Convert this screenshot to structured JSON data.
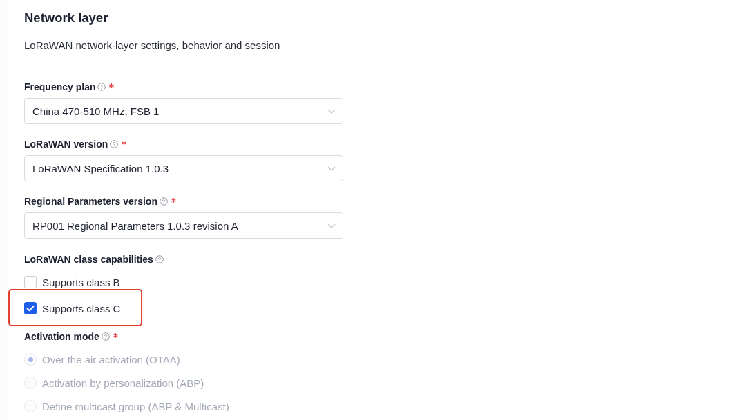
{
  "section": {
    "title": "Network layer",
    "description": "LoRaWAN network-layer settings, behavior and session"
  },
  "fields": [
    {
      "kind": "select",
      "label": "Frequency plan",
      "required": true,
      "value": "China 470-510 MHz, FSB 1"
    },
    {
      "kind": "select",
      "label": "LoRaWAN version",
      "required": true,
      "value": "LoRaWAN Specification 1.0.3"
    },
    {
      "kind": "select",
      "label": "Regional Parameters version",
      "required": true,
      "value": "RP001 Regional Parameters 1.0.3 revision A"
    },
    {
      "kind": "checkboxes",
      "label": "LoRaWAN class capabilities",
      "required": false,
      "options": [
        {
          "label": "Supports class B",
          "checked": false,
          "highlighted": false
        },
        {
          "label": "Supports class C",
          "checked": true,
          "highlighted": true
        }
      ]
    },
    {
      "kind": "radios",
      "label": "Activation mode",
      "required": true,
      "options": [
        {
          "label": "Over the air activation (OTAA)",
          "selected": true,
          "disabled": true
        },
        {
          "label": "Activation by personalization (ABP)",
          "selected": false,
          "disabled": true
        },
        {
          "label": "Define multicast group (ABP & Multicast)",
          "selected": false,
          "disabled": true
        }
      ]
    }
  ]
}
